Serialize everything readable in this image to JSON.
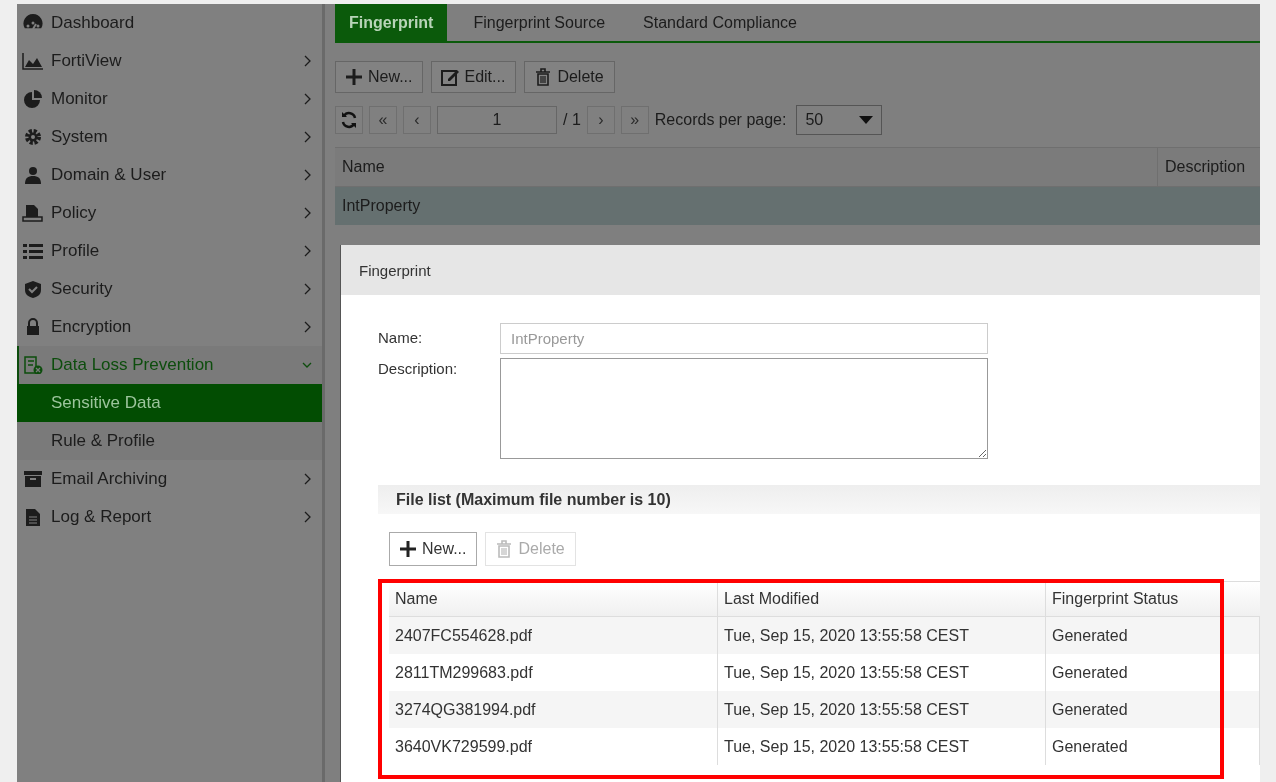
{
  "sidebar": {
    "items": [
      {
        "label": "Dashboard",
        "has_submenu": false,
        "expanded": false
      },
      {
        "label": "FortiView",
        "has_submenu": true,
        "expanded": false
      },
      {
        "label": "Monitor",
        "has_submenu": true,
        "expanded": false
      },
      {
        "label": "System",
        "has_submenu": true,
        "expanded": false
      },
      {
        "label": "Domain & User",
        "has_submenu": true,
        "expanded": false
      },
      {
        "label": "Policy",
        "has_submenu": true,
        "expanded": false
      },
      {
        "label": "Profile",
        "has_submenu": true,
        "expanded": false
      },
      {
        "label": "Security",
        "has_submenu": true,
        "expanded": false
      },
      {
        "label": "Encryption",
        "has_submenu": true,
        "expanded": false
      },
      {
        "label": "Data Loss Prevention",
        "has_submenu": true,
        "expanded": true,
        "children": [
          {
            "label": "Sensitive Data",
            "selected": true
          },
          {
            "label": "Rule & Profile",
            "selected": false
          }
        ]
      },
      {
        "label": "Email Archiving",
        "has_submenu": true,
        "expanded": false
      },
      {
        "label": "Log & Report",
        "has_submenu": true,
        "expanded": false
      }
    ]
  },
  "tabs": [
    {
      "label": "Fingerprint",
      "selected": true
    },
    {
      "label": "Fingerprint Source",
      "selected": false
    },
    {
      "label": "Standard Compliance",
      "selected": false
    }
  ],
  "toolbar": [
    {
      "kind": "new",
      "label": "New...",
      "disabled": false
    },
    {
      "kind": "edit",
      "label": "Edit...",
      "disabled": false
    },
    {
      "kind": "delete",
      "label": "Delete",
      "disabled": false
    }
  ],
  "pager": {
    "first": "«",
    "prev": "‹",
    "page": "1",
    "total": "/ 1",
    "next": "›",
    "last": "»",
    "per_page_label": "Records per page:",
    "per_page": "50"
  },
  "table": {
    "columns": [
      "Name",
      "Description"
    ],
    "rows": [
      {
        "name": "IntProperty",
        "selected": true
      }
    ]
  },
  "dialog": {
    "title": "Fingerprint",
    "name_label": "Name:",
    "name_value": "IntProperty",
    "name_disabled": true,
    "description_label": "Description:",
    "file_list_title": "File list (Maximum file number is 10)",
    "buttons": [
      {
        "kind": "new",
        "label": "New...",
        "disabled": false
      },
      {
        "kind": "delete",
        "label": "Delete",
        "disabled": true
      }
    ],
    "files": {
      "columns": [
        "Name",
        "Last Modified",
        "Fingerprint Status"
      ],
      "rows": [
        {
          "cells": [
            "2407FC554628.pdf",
            "Tue, Sep 15, 2020 13:55:58 CEST",
            "Generated"
          ]
        },
        {
          "cells": [
            "2811TM299683.pdf",
            "Tue, Sep 15, 2020 13:55:58 CEST",
            "Generated"
          ]
        },
        {
          "cells": [
            "3274QG381994.pdf",
            "Tue, Sep 15, 2020 13:55:58 CEST",
            "Generated"
          ]
        },
        {
          "cells": [
            "3640VK729599.pdf",
            "Tue, Sep 15, 2020 13:55:58 CEST",
            "Generated"
          ]
        }
      ]
    }
  }
}
